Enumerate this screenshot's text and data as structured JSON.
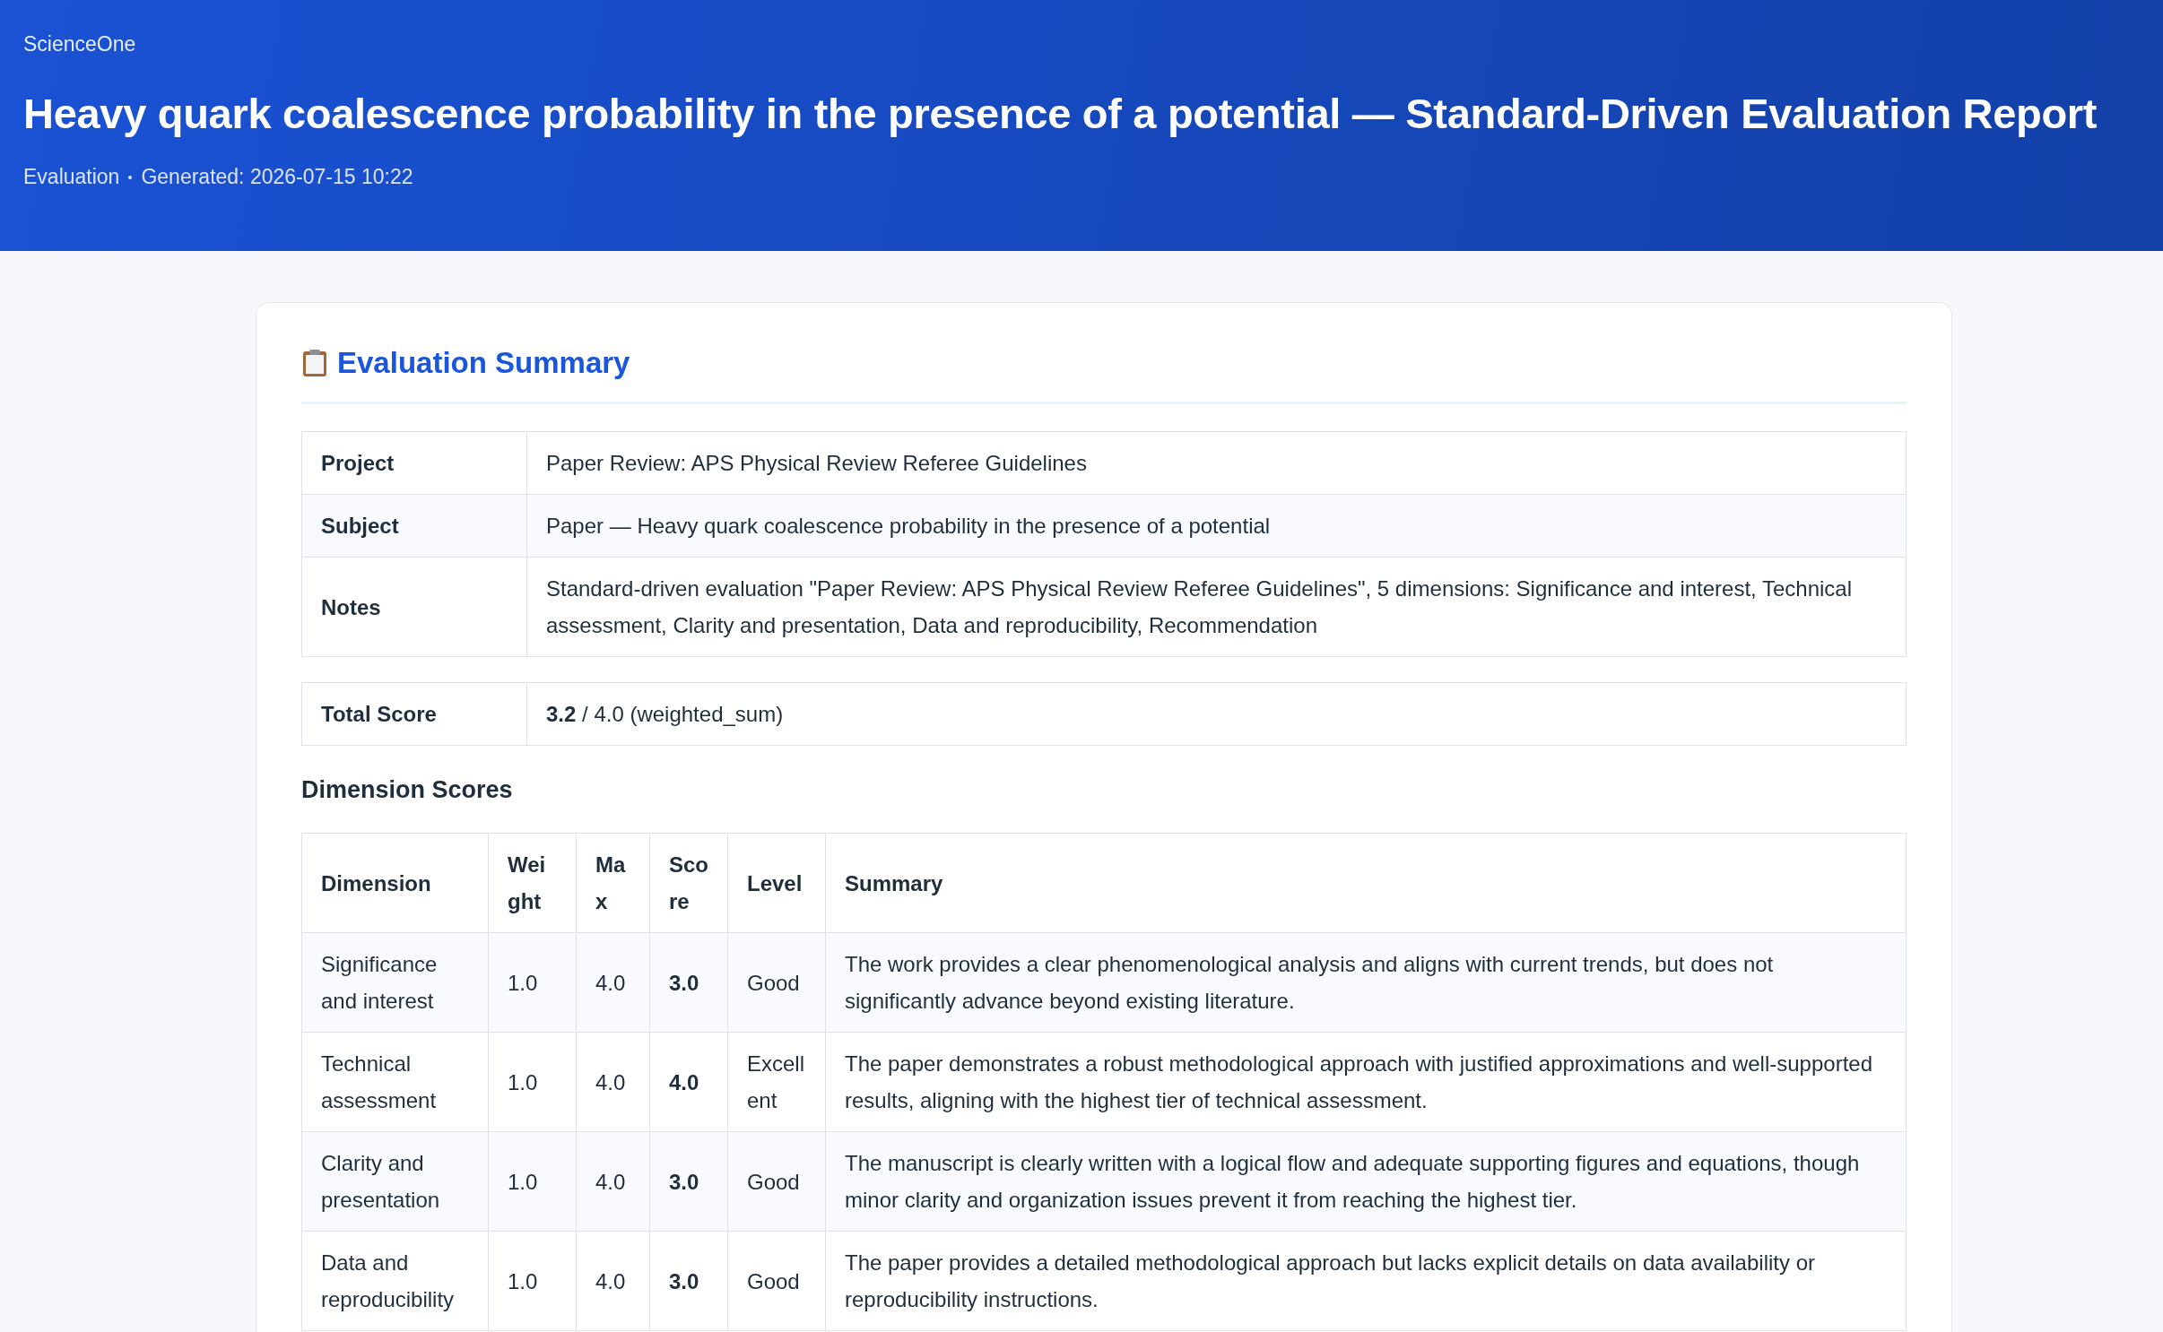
{
  "header": {
    "brand": "ScienceOne",
    "title": "Heavy quark coalescence probability in the presence of a potential — Standard-Driven Evaluation Report",
    "meta": [
      "Evaluation",
      "Generated: 2026-07-15 10:22"
    ]
  },
  "summary": {
    "heading": "Evaluation Summary",
    "info": [
      {
        "label": "Project",
        "value": "Paper Review: APS Physical Review Referee Guidelines"
      },
      {
        "label": "Subject",
        "value": "Paper — Heavy quark coalescence probability in the presence of a potential"
      },
      {
        "label": "Notes",
        "value": "Standard-driven evaluation \"Paper Review: APS Physical Review Referee Guidelines\", 5 dimensions: Significance and interest, Technical assessment, Clarity and presentation, Data and reproducibility, Recommendation"
      }
    ],
    "total": {
      "label": "Total Score",
      "value": "**3.2** / 4.0 (weighted_sum)"
    },
    "dimensions_heading": "Dimension Scores",
    "columns": [
      "Dimension",
      "Weight",
      "Max",
      "Score",
      "Level",
      "Summary"
    ],
    "rows": [
      {
        "dimension": "Significance and interest",
        "weight": "1.0",
        "max": "4.0",
        "score": "3.0",
        "level": "Good",
        "summary": "The work provides a clear phenomenological analysis and aligns with current trends, but does not significantly advance beyond existing literature."
      },
      {
        "dimension": "Technical assessment",
        "weight": "1.0",
        "max": "4.0",
        "score": "4.0",
        "level": "Excellent",
        "summary": "The paper demonstrates a robust methodological approach with justified approximations and well-supported results, aligning with the highest tier of technical assessment."
      },
      {
        "dimension": "Clarity and presentation",
        "weight": "1.0",
        "max": "4.0",
        "score": "3.0",
        "level": "Good",
        "summary": "The manuscript is clearly written with a logical flow and adequate supporting figures and equations, though minor clarity and organization issues prevent it from reaching the highest tier."
      },
      {
        "dimension": "Data and reproducibility",
        "weight": "1.0",
        "max": "4.0",
        "score": "3.0",
        "level": "Good",
        "summary": "The paper provides a detailed methodological approach but lacks explicit details on data availability or reproducibility instructions."
      }
    ]
  }
}
